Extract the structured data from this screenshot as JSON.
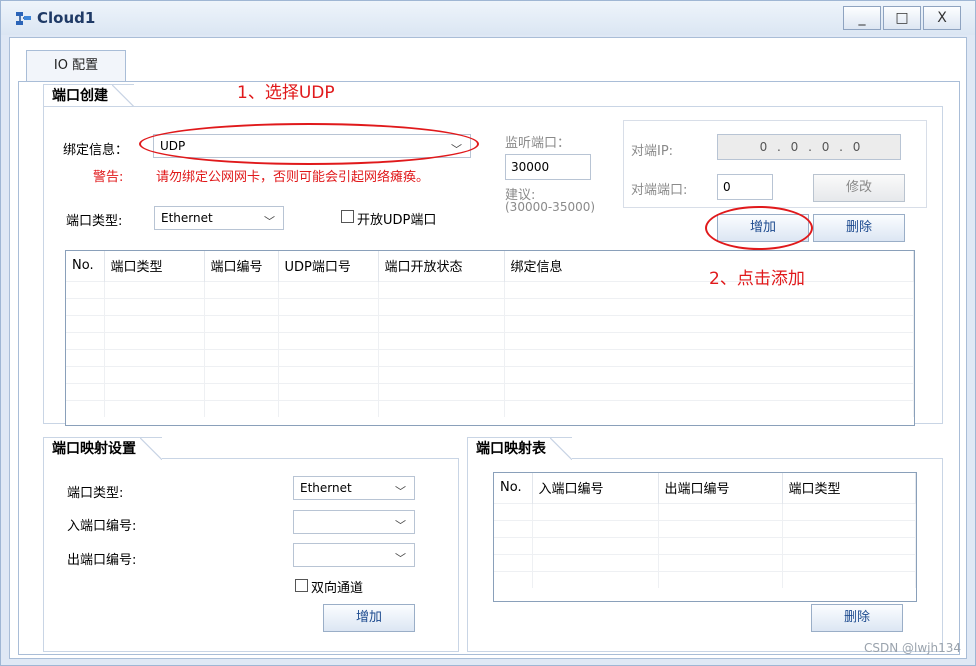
{
  "window": {
    "title": "Cloud1",
    "minimize": "_",
    "maximize": "□",
    "close": "X"
  },
  "tabs": {
    "io_config": "IO 配置"
  },
  "port_create": {
    "section_title": "端口创建",
    "bind_info_label": "绑定信息：",
    "bind_info_value": "UDP",
    "warning_label": "警告:",
    "warning_text": "请勿绑定公网网卡，否则可能会引起网络瘫痪。",
    "port_type_label": "端口类型:",
    "port_type_value": "Ethernet",
    "open_udp_label": "开放UDP端口",
    "listen_port_label": "监听端口：",
    "listen_port_value": "30000",
    "suggest_label": "建议:",
    "suggest_range": "(30000-35000)",
    "peer_ip_label": "对端IP:",
    "peer_ip_value": "0 . 0 . 0 . 0",
    "peer_port_label": "对端端口:",
    "peer_port_value": "0",
    "modify_button": "修改",
    "add_button": "增加",
    "delete_button": "删除",
    "table_headers": [
      "No.",
      "端口类型",
      "端口编号",
      "UDP端口号",
      "端口开放状态",
      "绑定信息"
    ]
  },
  "port_mapping": {
    "section_title": "端口映射设置",
    "port_type_label": "端口类型:",
    "port_type_value": "Ethernet",
    "in_port_label": "入端口编号:",
    "in_port_value": "",
    "out_port_label": "出端口编号:",
    "out_port_value": "",
    "bidirectional_label": "双向通道",
    "add_button": "增加"
  },
  "mapping_table": {
    "section_title": "端口映射表",
    "table_headers": [
      "No.",
      "入端口编号",
      "出端口编号",
      "端口类型"
    ],
    "delete_button": "删除"
  },
  "annotations": {
    "step1": "1、选择UDP",
    "step2": "2、点击添加",
    "color": "#e0191b"
  },
  "watermark": "CSDN @lwjh134"
}
